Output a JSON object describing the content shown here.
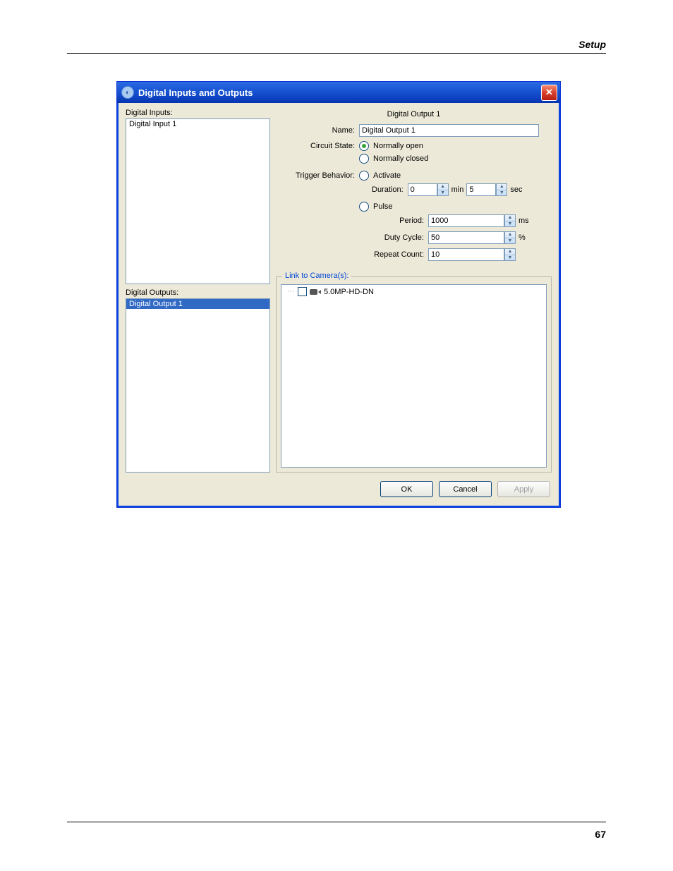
{
  "page": {
    "header": "Setup",
    "number": "67"
  },
  "dialog": {
    "title": "Digital Inputs and Outputs",
    "inputs_label": "Digital Inputs:",
    "outputs_label": "Digital Outputs:",
    "inputs": [
      "Digital Input 1"
    ],
    "outputs": [
      "Digital Output 1"
    ],
    "selected_output": "Digital Output 1"
  },
  "details": {
    "heading": "Digital Output 1",
    "name_label": "Name:",
    "name_value": "Digital Output 1",
    "circuit_label": "Circuit State:",
    "circuit_open": "Normally open",
    "circuit_closed": "Normally closed",
    "trigger_label": "Trigger Behavior:",
    "activate": "Activate",
    "duration_label": "Duration:",
    "duration_min": "0",
    "duration_sec": "5",
    "unit_min": "min",
    "unit_sec": "sec",
    "pulse": "Pulse",
    "period_label": "Period:",
    "period_value": "1000",
    "unit_ms": "ms",
    "duty_label": "Duty Cycle:",
    "duty_value": "50",
    "unit_pct": "%",
    "repeat_label": "Repeat Count:",
    "repeat_value": "10"
  },
  "link": {
    "legend": "Link to Camera(s):",
    "camera": "5.0MP-HD-DN"
  },
  "buttons": {
    "ok": "OK",
    "cancel": "Cancel",
    "apply": "Apply"
  }
}
